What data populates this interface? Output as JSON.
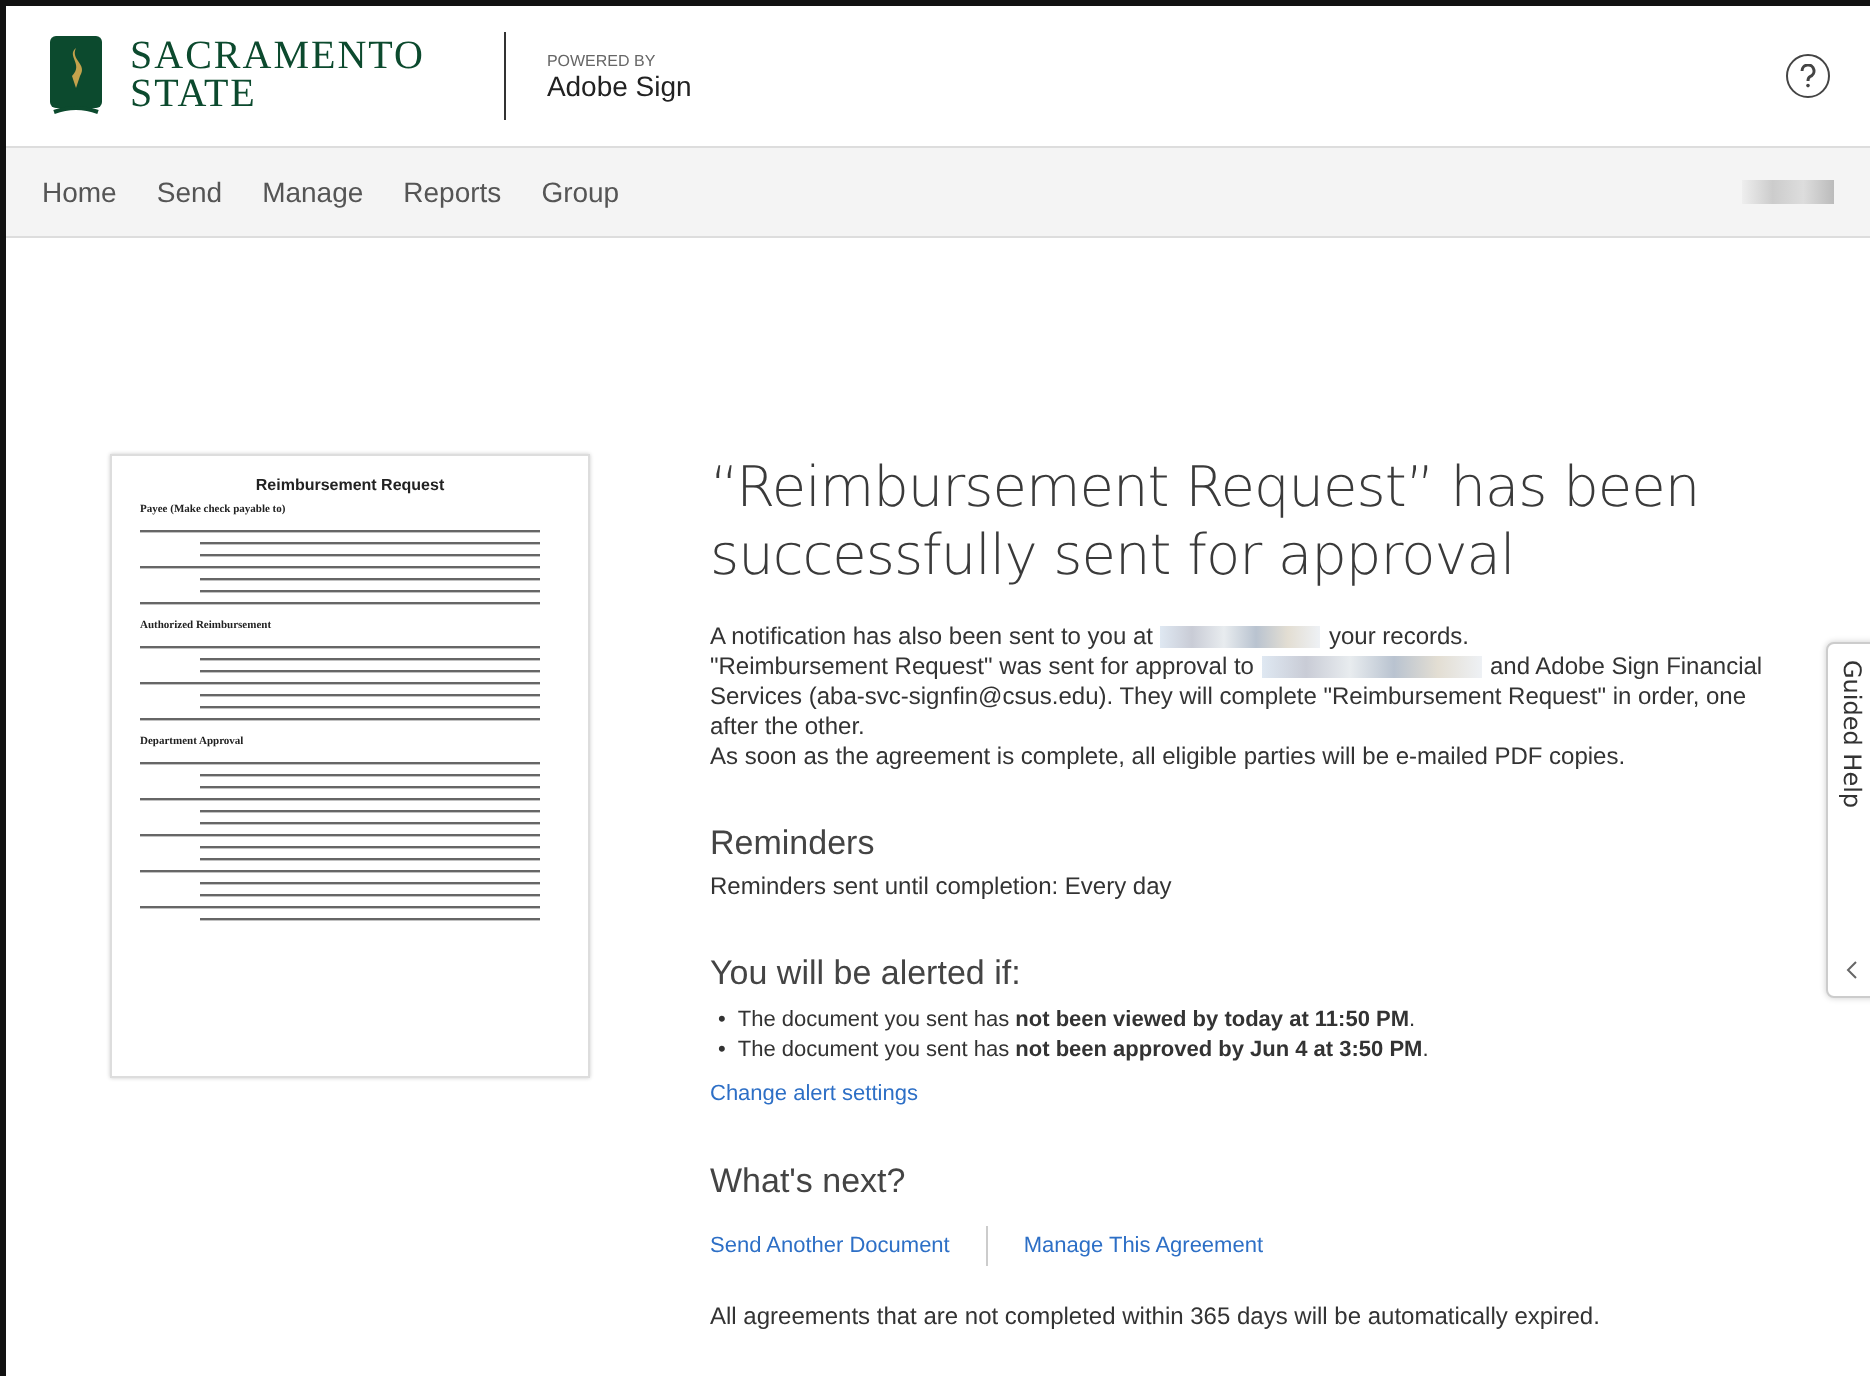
{
  "header": {
    "logo_lines": [
      "SACRAMENTO",
      "STATE"
    ],
    "powered_by": "POWERED BY",
    "product": "Adobe Sign"
  },
  "nav": {
    "items": [
      {
        "label": "Home",
        "selected": false
      },
      {
        "label": "Send",
        "selected": false
      },
      {
        "label": "Manage",
        "selected": false
      },
      {
        "label": "Reports",
        "selected": false
      },
      {
        "label": "Group",
        "selected": false
      }
    ]
  },
  "document_preview": {
    "title": "Reimbursement Request",
    "sections": [
      "Payee (Make check payable to)",
      "Authorized Reimbursement",
      "Department Approval"
    ]
  },
  "confirmation": {
    "title": "“Reimbursement Request” has been successfully sent for approval",
    "notification": {
      "before": "A notification has also been sent to you at",
      "after": "your records."
    },
    "sent_to": {
      "before": "\"Reimbursement Request\" was sent for approval to",
      "after": "and Adobe Sign Financial Services (aba-svc-signfin@csus.edu). They will complete \"Reimbursement Request\" in order, one after the other."
    },
    "completion_note": "As soon as the agreement is complete, all eligible parties will be e-mailed PDF copies."
  },
  "reminders": {
    "heading": "Reminders",
    "text": "Reminders sent until completion: Every day"
  },
  "alerts": {
    "heading": "You will be alerted if:",
    "items": [
      {
        "marker": "•",
        "text": "The document you sent has **not been viewed by today at 11:50 PM**."
      },
      {
        "marker": "•",
        "text": "The document you sent has **not been approved by Jun 4 at 3:50 PM**."
      }
    ],
    "link": "Change alert settings"
  },
  "whats_next": {
    "heading": "What's next?",
    "links": [
      "Send Another Document",
      "Manage This Agreement"
    ],
    "note": "All agreements that are not completed within 365 days will be automatically expired."
  },
  "guided_help": {
    "label": "Guided Help"
  }
}
